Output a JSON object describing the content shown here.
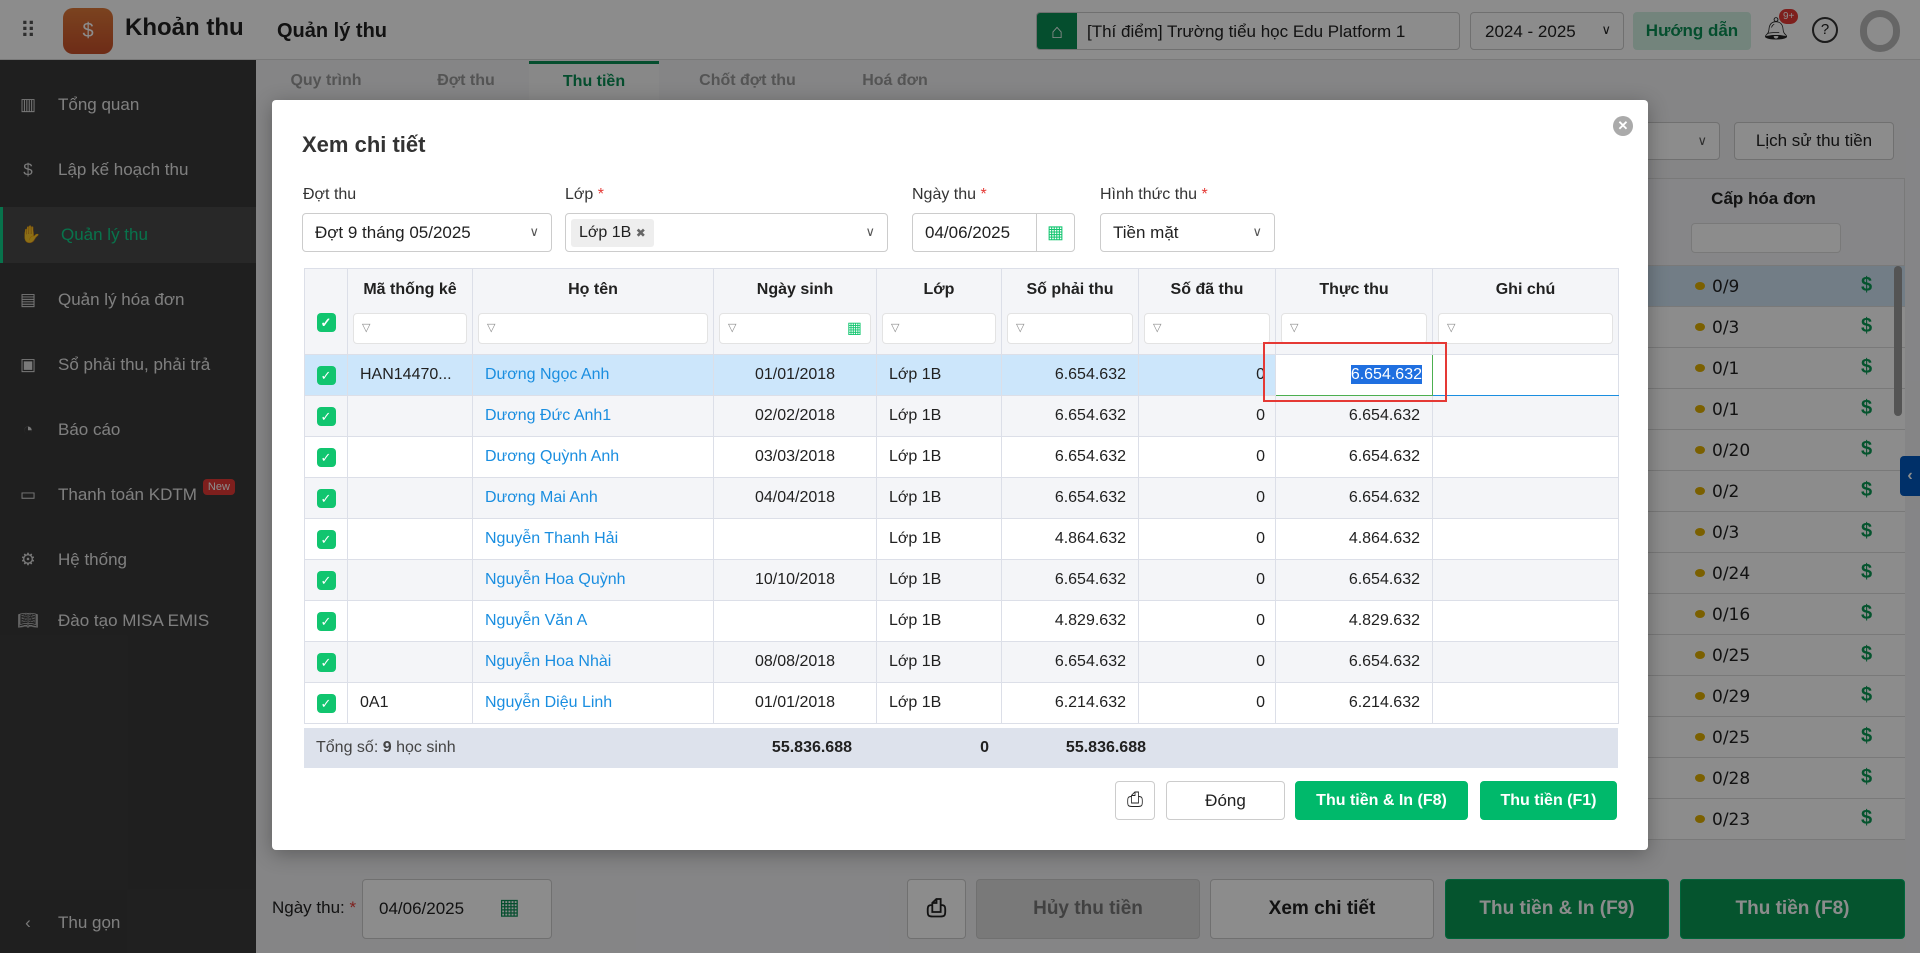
{
  "header": {
    "app_title": "Khoản thu",
    "page_title": "Quản lý thu",
    "school": "[Thí điểm] Trường tiểu học Edu Platform 1",
    "year": "2024 - 2025",
    "guide_label": "Hướng dẫn",
    "notif_badge": "9+"
  },
  "sidebar": {
    "items": [
      {
        "label": "Tổng quan",
        "icon": "bar-chart-icon"
      },
      {
        "label": "Lập kế hoạch thu",
        "icon": "calendar-dollar-icon"
      },
      {
        "label": "Quản lý thu",
        "icon": "hand-coin-icon",
        "active": true
      },
      {
        "label": "Quản lý hóa đơn",
        "icon": "document-icon"
      },
      {
        "label": "Sổ phải thu, phải trả",
        "icon": "ledger-icon"
      },
      {
        "label": "Báo cáo",
        "icon": "pie-chart-icon"
      },
      {
        "label": "Thanh toán KDTM",
        "icon": "card-icon",
        "badge": "New"
      },
      {
        "label": "Hệ thống",
        "icon": "gear-icon"
      },
      {
        "label": "Đào tạo MISA EMIS",
        "icon": "book-icon"
      }
    ],
    "collapse_label": "Thu gọn"
  },
  "tabs": [
    "Quy trình",
    "Đợt thu",
    "Thu tiền",
    "Chốt đợt thu",
    "Hoá đơn"
  ],
  "background": {
    "history_label": "Lịch sử thu tiền",
    "invoice_header": "Cấp hóa đơn",
    "invoice_values": [
      "0/9",
      "0/3",
      "0/1",
      "0/1",
      "0/20",
      "0/2",
      "0/3",
      "0/24",
      "0/16",
      "0/25",
      "0/29",
      "0/25",
      "0/28",
      "0/23"
    ],
    "footer": {
      "date_label": "Ngày thu:",
      "date_value": "04/06/2025",
      "cancel_label": "Hủy thu tiền",
      "detail_label": "Xem chi tiết",
      "collect_print_label": "Thu tiền & In (F9)",
      "collect_label": "Thu tiền (F8)"
    }
  },
  "modal": {
    "title": "Xem chi tiết",
    "fields": {
      "batch_label": "Đợt thu",
      "batch_value": "Đợt 9 tháng 05/2025",
      "class_label": "Lớp",
      "class_tag": "Lớp 1B",
      "date_label": "Ngày thu",
      "date_value": "04/06/2025",
      "method_label": "Hình thức thu",
      "method_value": "Tiền mặt"
    },
    "columns": [
      "Mã thống kê",
      "Họ tên",
      "Ngày sinh",
      "Lớp",
      "Số phải thu",
      "Số đã thu",
      "Thực thu",
      "Ghi chú"
    ],
    "rows": [
      {
        "code": "HAN14470...",
        "name": "Dương Ngọc Anh",
        "dob": "01/01/2018",
        "class": "Lớp 1B",
        "due": "6.654.632",
        "paid": "0",
        "actual": "6.654.632",
        "note": ""
      },
      {
        "code": "",
        "name": "Dương Đức Anh1",
        "dob": "02/02/2018",
        "class": "Lớp 1B",
        "due": "6.654.632",
        "paid": "0",
        "actual": "6.654.632",
        "note": ""
      },
      {
        "code": "",
        "name": "Dương Quỳnh Anh",
        "dob": "03/03/2018",
        "class": "Lớp 1B",
        "due": "6.654.632",
        "paid": "0",
        "actual": "6.654.632",
        "note": ""
      },
      {
        "code": "",
        "name": "Dương Mai Anh",
        "dob": "04/04/2018",
        "class": "Lớp 1B",
        "due": "6.654.632",
        "paid": "0",
        "actual": "6.654.632",
        "note": ""
      },
      {
        "code": "",
        "name": "Nguyễn Thanh Hải",
        "dob": "",
        "class": "Lớp 1B",
        "due": "4.864.632",
        "paid": "0",
        "actual": "4.864.632",
        "note": ""
      },
      {
        "code": "",
        "name": "Nguyễn Hoa Quỳnh",
        "dob": "10/10/2018",
        "class": "Lớp 1B",
        "due": "6.654.632",
        "paid": "0",
        "actual": "6.654.632",
        "note": ""
      },
      {
        "code": "",
        "name": "Nguyễn Văn A",
        "dob": "",
        "class": "Lớp 1B",
        "due": "4.829.632",
        "paid": "0",
        "actual": "4.829.632",
        "note": ""
      },
      {
        "code": "",
        "name": "Nguyễn Hoa Nhài",
        "dob": "08/08/2018",
        "class": "Lớp 1B",
        "due": "6.654.632",
        "paid": "0",
        "actual": "6.654.632",
        "note": ""
      },
      {
        "code": "0A1",
        "name": "Nguyễn Diệu Linh",
        "dob": "01/01/2018",
        "class": "Lớp 1B",
        "due": "6.214.632",
        "paid": "0",
        "actual": "6.214.632",
        "note": ""
      }
    ],
    "totals": {
      "label_prefix": "Tổng số:",
      "count": "9",
      "label_suffix": "học sinh",
      "due": "55.836.688",
      "paid": "0",
      "actual": "55.836.688"
    },
    "buttons": {
      "close": "Đóng",
      "collect_print": "Thu tiền & In (F8)",
      "collect": "Thu tiền (F1)"
    }
  },
  "colors": {
    "accent": "#00b96b",
    "link": "#1a8ee0",
    "selected_row": "#cce6fb",
    "highlight_box": "#e53935"
  }
}
